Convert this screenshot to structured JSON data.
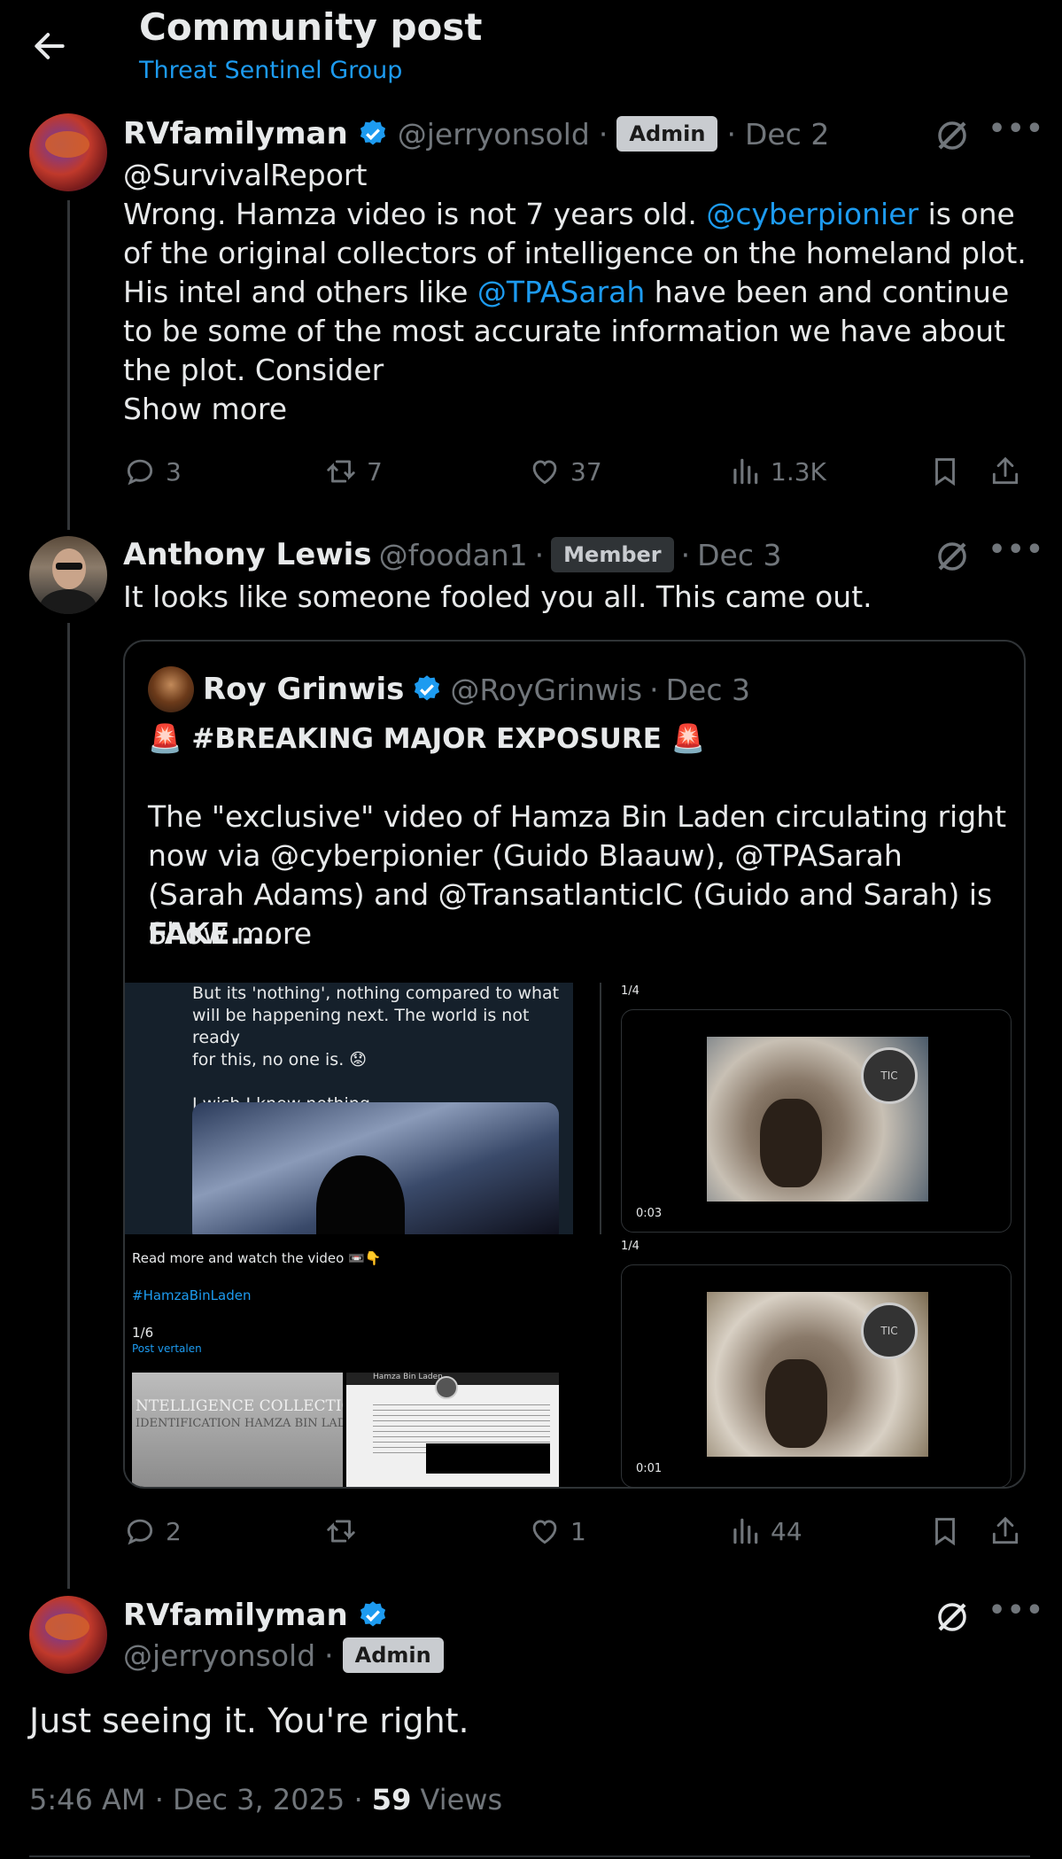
{
  "header": {
    "title": "Community post",
    "subtitle": "Threat Sentinel Group"
  },
  "post1": {
    "name": "RVfamilyman",
    "handle": "@jerryonsold",
    "badge": "Admin",
    "date": "Dec 2",
    "mention": "@SurvivalReport",
    "text_a": "Wrong. Hamza video is not 7 years old. ",
    "mention2": "@cyberpionier",
    "text_b": " is one of the original collectors of intelligence on the homeland plot. His intel and others like ",
    "mention3": "@TPASarah",
    "text_c": " have been and continue to be some of the most accurate information we have about the plot. Consider",
    "show_more": "Show more",
    "replies": "3",
    "reposts": "7",
    "likes": "37",
    "views": "1.3K"
  },
  "post2": {
    "name": "Anthony Lewis",
    "handle": "@foodan1",
    "badge": "Member",
    "date": "Dec 3",
    "text": "It looks like someone fooled you all. This came out.",
    "replies": "2",
    "reposts": "",
    "likes": "1",
    "views": "44",
    "quote": {
      "name": "Roy Grinwis",
      "handle": "@RoyGrinwis",
      "date": "Dec 3",
      "headline_emoji": "🚨",
      "headline": "#BREAKING MAJOR EXPOSURE",
      "text": "The \"exclusive\" video of Hamza Bin Laden circulating right now via @cyberpionier (Guido Blaauw), @TPASarah (Sarah Adams) and @TransatlanticIC (Guido and Sarah) is ",
      "text_bold": "FAKE....",
      "show_more": "Show more",
      "img1": {
        "line1": "But its 'nothing', nothing compared to what",
        "line2": "will be happening next. The world is not ready",
        "line3": "for this, no one is. 😟",
        "line4": "I wish I knew nothing."
      },
      "img2": {
        "counter": "1/4",
        "time": "0:03",
        "logo": "TIC"
      },
      "img3": {
        "line1": "Read more and watch the video 📼👇",
        "tag": "#HamzaBinLaden",
        "counter": "1/6",
        "translate": "Post vertalen",
        "doc_title1": "NTELLIGENCE COLLECTIO",
        "doc_title2": "IDENTIFICATION HAMZA BIN LADEN",
        "doc_header": "Hamza Bin Laden"
      },
      "img4": {
        "counter": "1/4",
        "time": "0:01",
        "logo": "TIC"
      }
    }
  },
  "post3": {
    "name": "RVfamilyman",
    "handle": "@jerryonsold",
    "badge": "Admin",
    "text": "Just seeing it. You're right.",
    "time": "5:46 AM",
    "date": "Dec 3, 2025",
    "views_count": "59",
    "views_label": "Views"
  },
  "colors": {
    "accent": "#1d9bf0",
    "muted": "#71767b",
    "text": "#e7e9ea",
    "border": "#2f3336"
  }
}
